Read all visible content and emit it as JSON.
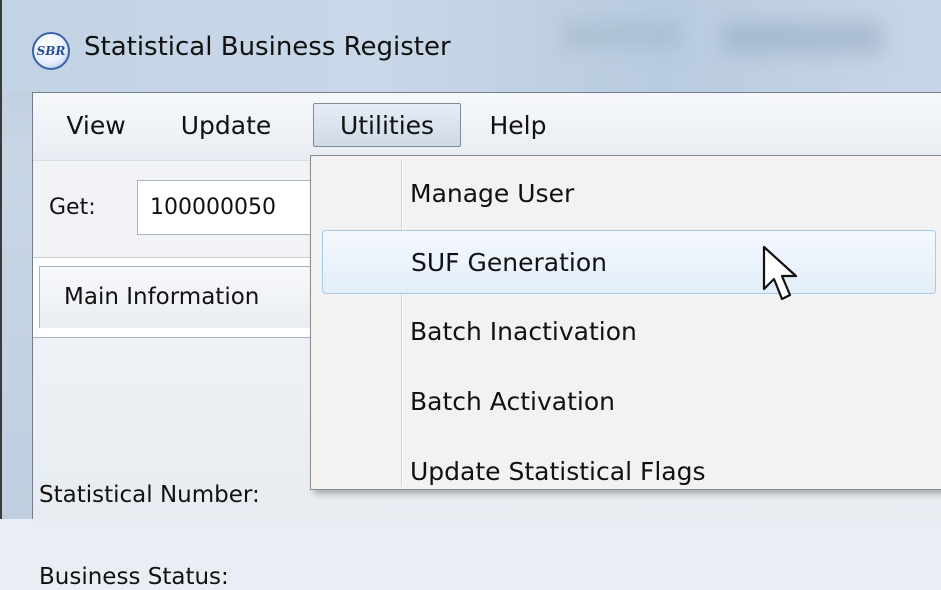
{
  "window": {
    "title": "Statistical Business Register",
    "icon_text": "SBR"
  },
  "menu": {
    "items": [
      {
        "label": "View"
      },
      {
        "label": "Update"
      },
      {
        "label": "Utilities",
        "active": true
      },
      {
        "label": "Help"
      }
    ]
  },
  "get_bar": {
    "label": "Get:",
    "value": "100000050"
  },
  "tabs": [
    {
      "label": "Main Information"
    }
  ],
  "fields": [
    {
      "label": "Statistical Number:"
    },
    {
      "label": "Business Status:"
    }
  ],
  "utilities_menu": {
    "items": [
      {
        "label": "Manage User"
      },
      {
        "label": "SUF Generation",
        "highlighted": true
      },
      {
        "label": "Batch Inactivation"
      },
      {
        "label": "Batch Activation"
      },
      {
        "label": "Update Statistical Flags"
      }
    ]
  },
  "colors": {
    "highlight_border": "#a8cbe9",
    "highlight_fill": "#e3eef9",
    "menu_active_border": "#7f8b99",
    "dropdown_bg": "#f2f2f2"
  },
  "icons": {
    "app": "sbr-logo-icon",
    "cursor": "mouse-pointer-icon"
  }
}
